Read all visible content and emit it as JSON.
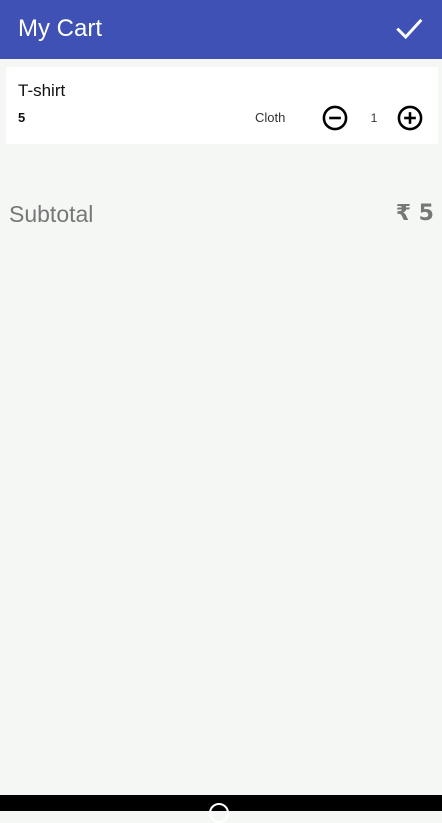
{
  "app_bar": {
    "title": "My Cart",
    "confirm_icon": "check-icon"
  },
  "cart": {
    "items": [
      {
        "name": "T-shirt",
        "price": "5",
        "category": "Cloth",
        "quantity": "1",
        "decrease_icon": "minus-circle-icon",
        "increase_icon": "plus-circle-icon"
      }
    ]
  },
  "summary": {
    "subtotal_label": "Subtotal",
    "subtotal_value": "₹ 5"
  },
  "colors": {
    "primary": "#3f51b5",
    "background": "#f5f7f5",
    "card": "#ffffff",
    "subtotal_text": "#777777"
  }
}
